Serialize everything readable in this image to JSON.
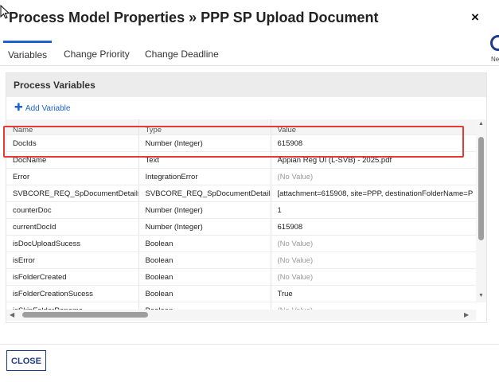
{
  "dialog": {
    "title": "Process Model Properties » PPP SP Upload Document",
    "close_symbol": "×"
  },
  "tabs": [
    {
      "label": "Variables"
    },
    {
      "label": "Change Priority"
    },
    {
      "label": "Change Deadline"
    }
  ],
  "panel": {
    "header": "Process Variables",
    "add_label": "Add Variable"
  },
  "table": {
    "columns": [
      "Name",
      "Type",
      "Value"
    ],
    "rows": [
      {
        "name": "DocIds",
        "type": "Number (Integer)",
        "value": "615908"
      },
      {
        "name": "DocName",
        "type": "Text",
        "value": "Appian Reg UI (L-SVB) - 2025.pdf"
      },
      {
        "name": "Error",
        "type": "IntegrationError",
        "value": "(No Value)"
      },
      {
        "name": "SVBCORE_REQ_SpDocumentDetails",
        "type": "SVBCORE_REQ_SpDocumentDetails",
        "value": "[attachment=615908, site=PPP, destinationFolderName=P"
      },
      {
        "name": "counterDoc",
        "type": "Number (Integer)",
        "value": "1"
      },
      {
        "name": "currentDocId",
        "type": "Number (Integer)",
        "value": "615908"
      },
      {
        "name": "isDocUploadSucess",
        "type": "Boolean",
        "value": "(No Value)"
      },
      {
        "name": "isError",
        "type": "Boolean",
        "value": "(No Value)"
      },
      {
        "name": "isFolderCreated",
        "type": "Boolean",
        "value": "(No Value)"
      },
      {
        "name": "isFolderCreationSucess",
        "type": "Boolean",
        "value": "True"
      },
      {
        "name": "isSkipFolderRename",
        "type": "Boolean",
        "value": "(No Value)"
      }
    ]
  },
  "footer": {
    "close_label": "CLOSE"
  },
  "sidebar_fragment": {
    "text": "Ne"
  },
  "colors": {
    "accent": "#1d62cf",
    "highlight": "#e53935",
    "navy": "#1d3b8a"
  }
}
